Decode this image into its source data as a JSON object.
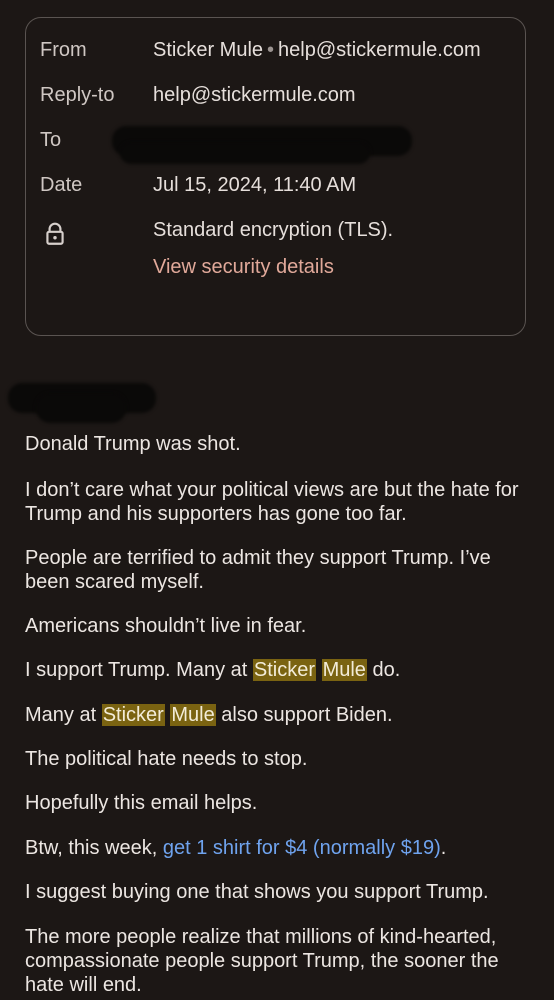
{
  "header": {
    "from_label": "From",
    "from_name": "Sticker Mule",
    "from_sep": "•",
    "from_email": "help@stickermule.com",
    "replyto_label": "Reply-to",
    "replyto_email": "help@stickermule.com",
    "to_label": "To",
    "date_label": "Date",
    "date_value": "Jul 15, 2024, 11:40 AM",
    "encryption_text": "Standard encryption (TLS).",
    "security_link": "View security details"
  },
  "icons": {
    "lock": "lock-icon"
  },
  "body": {
    "p1": "Donald Trump was shot.",
    "p2": "I don’t care what your political views are but the hate for Trump and his supporters has gone too far.",
    "p3": "People are terrified to admit they support Trump. I’ve been scared myself.",
    "p4": "Americans shouldn’t live in fear.",
    "p5_pre": "I support Trump. Many at ",
    "p5_hl1": "Sticker",
    "p5_hl2": "Mule",
    "p5_post": " do.",
    "p6_pre": "Many at ",
    "p6_hl1": "Sticker",
    "p6_hl2": "Mule",
    "p6_post": " also support Biden.",
    "p7": "The political hate needs to stop.",
    "p8": "Hopefully this email helps.",
    "p9_pre": "Btw, this week, ",
    "p9_link": "get 1 shirt for $4 (normally $19)",
    "p9_post": ".",
    "p10": "I suggest buying one that shows you support Trump.",
    "p11": "The more people realize that millions of kind-hearted, compassionate people support Trump, the sooner the hate will end."
  },
  "colors": {
    "background": "#1c1715",
    "highlight": "#7a6311",
    "link": "#6fa3ee",
    "security_link": "#e1a99a"
  }
}
